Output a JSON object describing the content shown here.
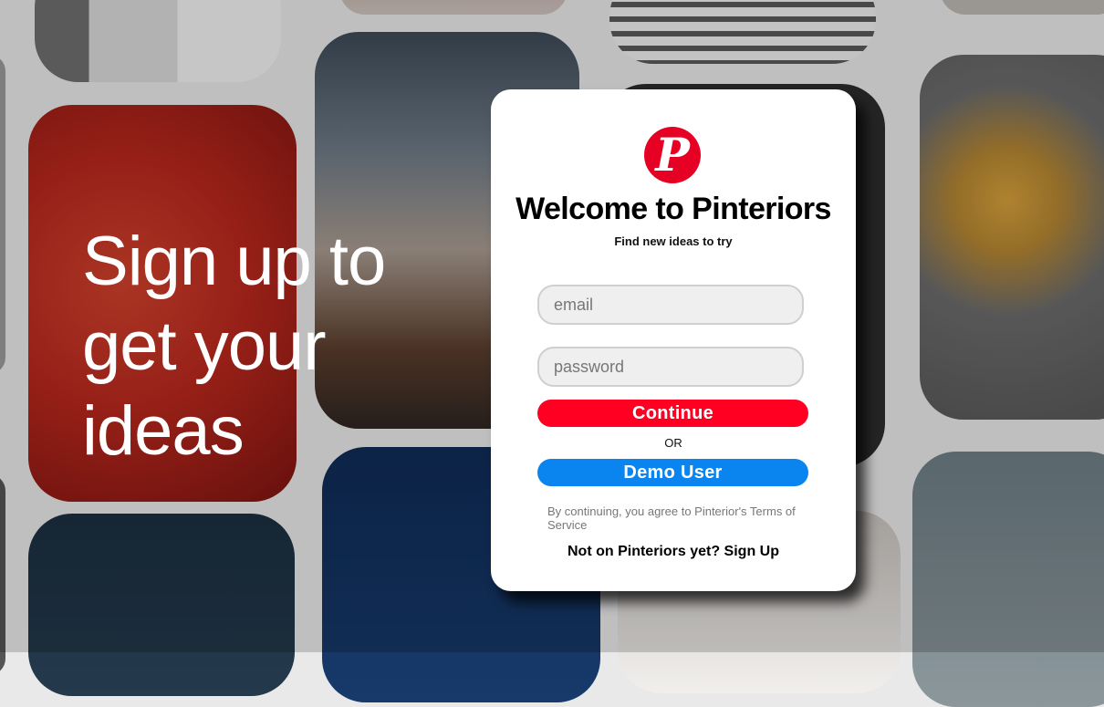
{
  "hero": {
    "lines": [
      "Sign up to",
      "get your",
      "ideas"
    ]
  },
  "card": {
    "logo_letter": "P",
    "title": "Welcome to Pinteriors",
    "subtitle": "Find new ideas to try",
    "email_placeholder": "email",
    "email_value": "",
    "password_placeholder": "password",
    "password_value": "",
    "continue_label": "Continue",
    "or_label": "OR",
    "demo_label": "Demo User",
    "terms_text": "By continuing, you agree to Pinterior's Terms of Service",
    "signup_text": "Not on Pinteriors yet? Sign Up"
  },
  "colors": {
    "brand_red": "#e60023",
    "continue_red": "#ff0022",
    "demo_blue": "#0a84ef"
  }
}
